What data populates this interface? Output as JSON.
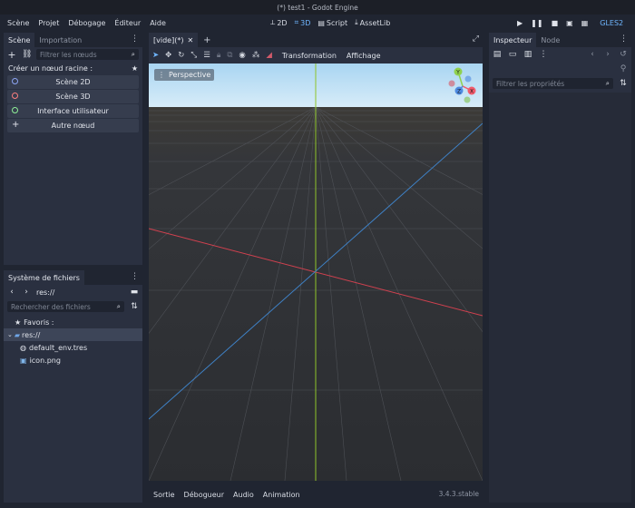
{
  "window_title": "(*) test1 - Godot Engine",
  "menu": [
    "Scène",
    "Projet",
    "Débogage",
    "Éditeur",
    "Aide"
  ],
  "workspaces": [
    {
      "label": "2D",
      "icon": "2d-icon"
    },
    {
      "label": "3D",
      "icon": "3d-icon"
    },
    {
      "label": "Script",
      "icon": "script-icon"
    },
    {
      "label": "AssetLib",
      "icon": "assetlib-icon"
    }
  ],
  "renderer": "GLES2",
  "scene_dock": {
    "tabs": [
      "Scène",
      "Importation"
    ],
    "filter_placeholder": "Filtrer les nœuds",
    "create_root_label": "Créer un nœud racine :",
    "buttons": [
      {
        "label": "Scène 2D",
        "color": "#8da5f3"
      },
      {
        "label": "Scène 3D",
        "color": "#fc7f7f"
      },
      {
        "label": "Interface utilisateur",
        "color": "#8eef97"
      },
      {
        "label": "Autre nœud",
        "color": ""
      }
    ]
  },
  "filesystem": {
    "tab": "Système de fichiers",
    "path": "res://",
    "search_placeholder": "Rechercher des fichiers",
    "favorites": "Favoris :",
    "root": "res://",
    "files": [
      "default_env.tres",
      "icon.png"
    ]
  },
  "editor": {
    "scene_tab": "[vide](*)",
    "toolbar_menus": [
      "Transformation",
      "Affichage"
    ],
    "perspective_label": "Perspective"
  },
  "gizmo_axes": [
    "Y",
    "X",
    "Z"
  ],
  "bottom_panel": {
    "tabs": [
      "Sortie",
      "Débogueur",
      "Audio",
      "Animation"
    ],
    "version": "3.4.3.stable"
  },
  "inspector": {
    "tabs": [
      "Inspecteur",
      "Node"
    ],
    "filter_placeholder": "Filtrer les propriétés"
  }
}
